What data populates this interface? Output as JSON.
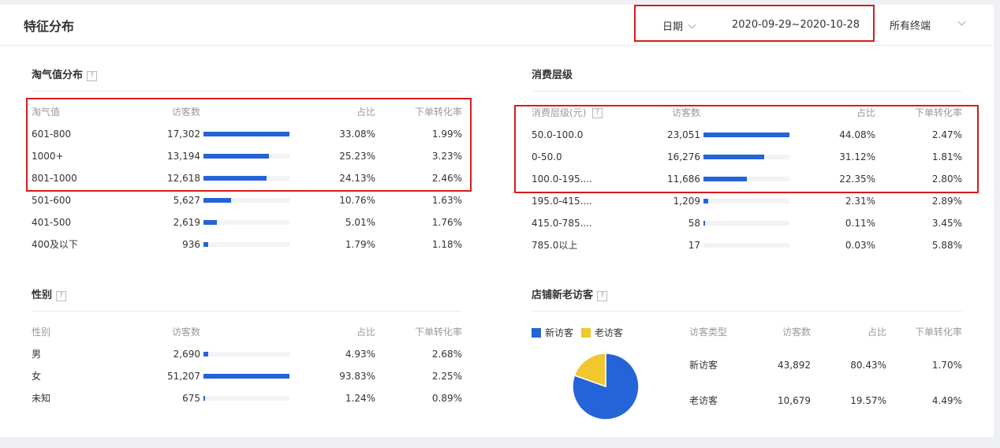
{
  "header": {
    "title": "特征分布",
    "date_label": "日期",
    "date_range": "2020-09-29~2020-10-28",
    "terminal_label": "所有终端"
  },
  "colors": {
    "bar": "#2563d8",
    "new_visitor": "#2563d8",
    "old_visitor": "#f2c62e",
    "highlight": "#d61c1c"
  },
  "taoqi": {
    "title": "淘气值分布",
    "help": "?",
    "columns": [
      "淘气值",
      "访客数",
      "占比",
      "下单转化率"
    ],
    "rows": [
      {
        "label": "601-800",
        "visitors": "17,302",
        "share": "33.08%",
        "conv": "1.99%",
        "pct": 33.08
      },
      {
        "label": "1000+",
        "visitors": "13,194",
        "share": "25.23%",
        "conv": "3.23%",
        "pct": 25.23
      },
      {
        "label": "801-1000",
        "visitors": "12,618",
        "share": "24.13%",
        "conv": "2.46%",
        "pct": 24.13
      },
      {
        "label": "501-600",
        "visitors": "5,627",
        "share": "10.76%",
        "conv": "1.63%",
        "pct": 10.76
      },
      {
        "label": "401-500",
        "visitors": "2,619",
        "share": "5.01%",
        "conv": "1.76%",
        "pct": 5.01
      },
      {
        "label": "400及以下",
        "visitors": "936",
        "share": "1.79%",
        "conv": "1.18%",
        "pct": 1.79
      }
    ]
  },
  "consumption": {
    "title": "消费层级",
    "help": "?",
    "columns": [
      "消费层级(元)",
      "访客数",
      "占比",
      "下单转化率"
    ],
    "rows": [
      {
        "label": "50.0-100.0",
        "visitors": "23,051",
        "share": "44.08%",
        "conv": "2.47%",
        "pct": 44.08
      },
      {
        "label": "0-50.0",
        "visitors": "16,276",
        "share": "31.12%",
        "conv": "1.81%",
        "pct": 31.12
      },
      {
        "label": "100.0-195....",
        "visitors": "11,686",
        "share": "22.35%",
        "conv": "2.80%",
        "pct": 22.35
      },
      {
        "label": "195.0-415....",
        "visitors": "1,209",
        "share": "2.31%",
        "conv": "2.89%",
        "pct": 2.31
      },
      {
        "label": "415.0-785....",
        "visitors": "58",
        "share": "0.11%",
        "conv": "3.45%",
        "pct": 0.11
      },
      {
        "label": "785.0以上",
        "visitors": "17",
        "share": "0.03%",
        "conv": "5.88%",
        "pct": 0.03
      }
    ]
  },
  "gender": {
    "title": "性别",
    "help": "?",
    "columns": [
      "性别",
      "访客数",
      "占比",
      "下单转化率"
    ],
    "rows": [
      {
        "label": "男",
        "visitors": "2,690",
        "share": "4.93%",
        "conv": "2.68%",
        "pct": 4.93
      },
      {
        "label": "女",
        "visitors": "51,207",
        "share": "93.83%",
        "conv": "2.25%",
        "pct": 93.83
      },
      {
        "label": "未知",
        "visitors": "675",
        "share": "1.24%",
        "conv": "0.89%",
        "pct": 1.24
      }
    ]
  },
  "visitors": {
    "title": "店铺新老访客",
    "help": "?",
    "legend": [
      "新访客",
      "老访客"
    ],
    "columns": [
      "访客类型",
      "访客数",
      "占比",
      "下单转化率"
    ],
    "rows": [
      {
        "label": "新访客",
        "visitors": "43,892",
        "share": "80.43%",
        "conv": "1.70%",
        "pct": 80.43
      },
      {
        "label": "老访客",
        "visitors": "10,679",
        "share": "19.57%",
        "conv": "4.49%",
        "pct": 19.57
      }
    ]
  }
}
